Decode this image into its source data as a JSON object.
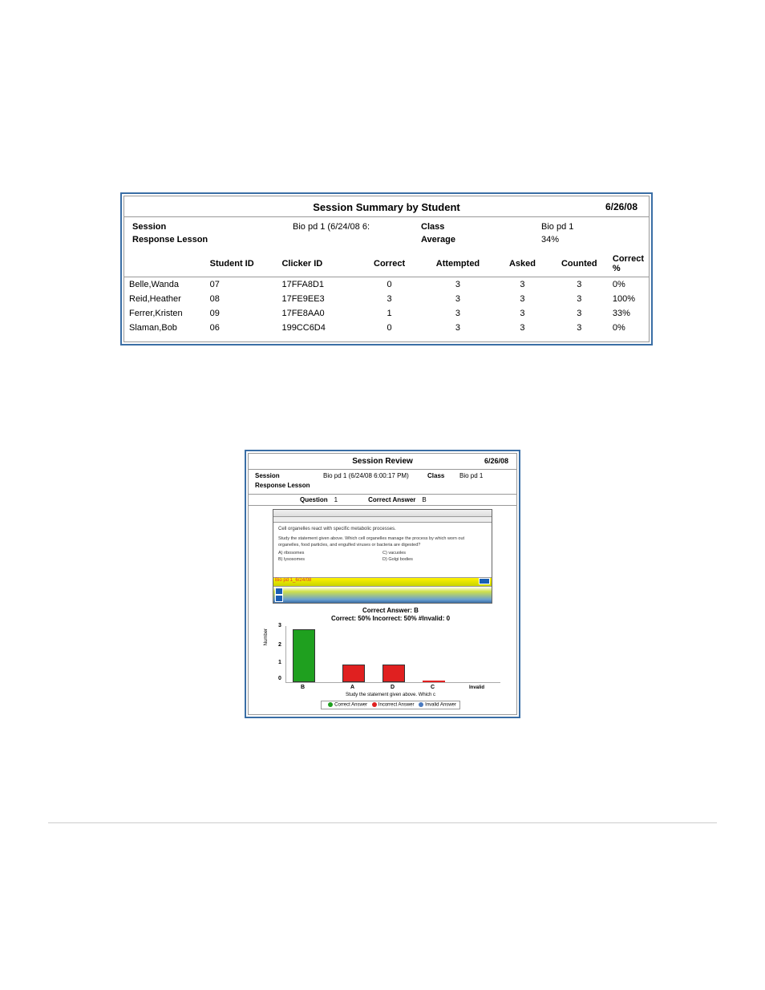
{
  "report1": {
    "title": "Session Summary by Student",
    "date": "6/26/08",
    "session_label": "Session",
    "session_value": "Bio pd 1 (6/24/08 6:",
    "class_label": "Class",
    "class_value": "Bio pd 1",
    "rl_label": "Response Lesson",
    "rl_value": "",
    "avg_label": "Average",
    "avg_value": "34%",
    "headers": {
      "name": "",
      "student_id": "Student ID",
      "clicker_id": "Clicker ID",
      "correct": "Correct",
      "attempted": "Attempted",
      "asked": "Asked",
      "counted": "Counted",
      "correct_pct": "Correct  %"
    },
    "rows": [
      {
        "name": "Belle,Wanda",
        "student_id": "07",
        "clicker_id": "17FFA8D1",
        "correct": "0",
        "attempted": "3",
        "asked": "3",
        "counted": "3",
        "correct_pct": "0%"
      },
      {
        "name": "Reid,Heather",
        "student_id": "08",
        "clicker_id": "17FE9EE3",
        "correct": "3",
        "attempted": "3",
        "asked": "3",
        "counted": "3",
        "correct_pct": "100%"
      },
      {
        "name": "Ferrer,Kristen",
        "student_id": "09",
        "clicker_id": "17FE8AA0",
        "correct": "1",
        "attempted": "3",
        "asked": "3",
        "counted": "3",
        "correct_pct": "33%"
      },
      {
        "name": "Slaman,Bob",
        "student_id": "06",
        "clicker_id": "199CC6D4",
        "correct": "0",
        "attempted": "3",
        "asked": "3",
        "counted": "3",
        "correct_pct": "0%"
      }
    ]
  },
  "report2": {
    "title": "Session Review",
    "date": "6/26/08",
    "session_label": "Session",
    "session_value": "Bio pd 1 (6/24/08 6:00:17 PM)",
    "class_label": "Class",
    "class_value": "Bio pd 1",
    "rl_label": "Response Lesson",
    "question_label": "Question",
    "question_num": "1",
    "ca_label": "Correct Answer",
    "ca_value": "B",
    "slide": {
      "statement": "Cell organelles react with specific metabolic processes.",
      "question": "Study the statement given above. Which cell organelles manage the process by which worn out organelles, food particles, and engulfed viruses or bacteria are digested?",
      "opt_a": "A)  ribosomes",
      "opt_b": "B)  lysosomes",
      "opt_c": "C)  vacuoles",
      "opt_d": "D)  Golgi bodies",
      "footer_label": "Bio pd 1_6/24/08"
    },
    "chart_title": "Correct Answer: B",
    "chart_sub": "Correct: 50%  Incorrect: 50%  #Invalid: 0",
    "xlabel": "Study the statement given above. Which c",
    "ylabel": "Number",
    "legend_correct": "Correct Answer",
    "legend_incorrect": "Incorrect Answer",
    "legend_invalid": "Invalid Answer"
  },
  "chart_data": {
    "type": "bar",
    "title": "Correct Answer: B",
    "subtitle": "Correct: 50%  Incorrect: 50%  #Invalid: 0",
    "xlabel": "Study the statement given above. Which c",
    "ylabel": "Number",
    "ylim": [
      0,
      3
    ],
    "categories": [
      "B",
      "A",
      "D",
      "C",
      "Invalid"
    ],
    "values": [
      3,
      1,
      1,
      0,
      0
    ],
    "series_colors": {
      "B": "correct",
      "A": "incorrect",
      "D": "incorrect",
      "C": "incorrect",
      "Invalid": "invalid"
    },
    "legend": [
      "Correct Answer",
      "Incorrect Answer",
      "Invalid Answer"
    ]
  }
}
